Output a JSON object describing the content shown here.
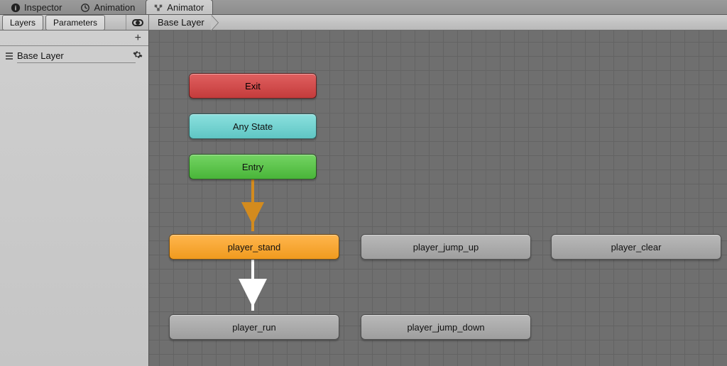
{
  "tabs": {
    "inspector": "Inspector",
    "animation": "Animation",
    "animator": "Animator"
  },
  "subtabs": {
    "layers": "Layers",
    "parameters": "Parameters"
  },
  "breadcrumb": "Base Layer",
  "sidebar": {
    "layer_name": "Base Layer",
    "add_symbol": "+"
  },
  "nodes": {
    "exit": "Exit",
    "any": "Any State",
    "entry": "Entry",
    "player_stand": "player_stand",
    "player_jump_up": "player_jump_up",
    "player_clear": "player_clear",
    "player_run": "player_run",
    "player_jump_down": "player_jump_down"
  },
  "colors": {
    "exit": "#c43b3b",
    "any": "#5fc6c4",
    "entry": "#49b539",
    "default_state": "#f09a1e",
    "state": "#9e9e9e"
  }
}
